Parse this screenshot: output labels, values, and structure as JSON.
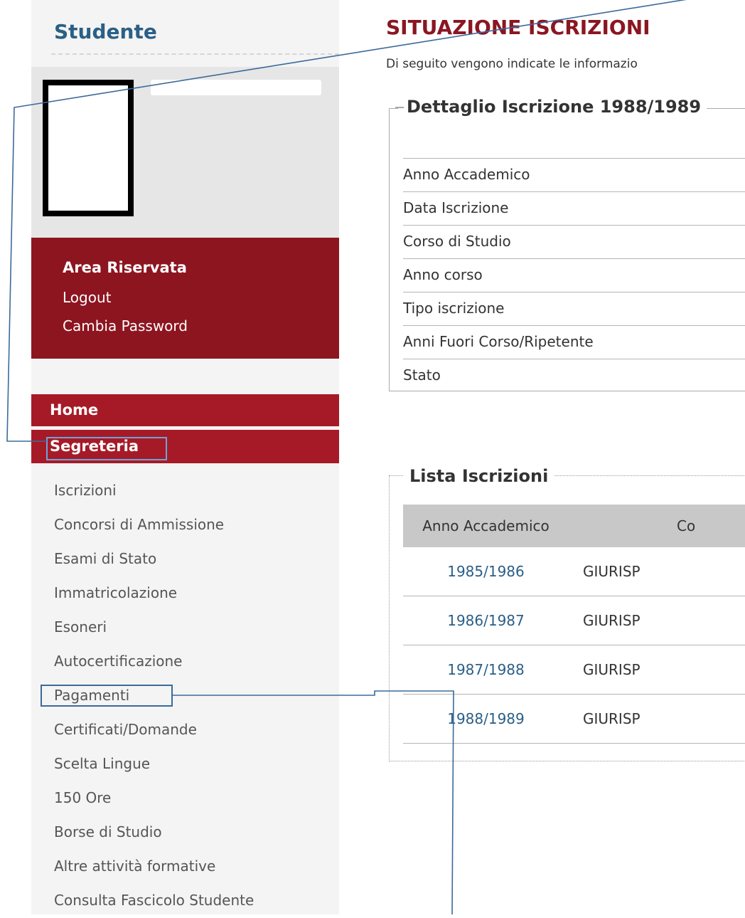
{
  "sidebar": {
    "title": "Studente",
    "reserved": {
      "title": "Area Riservata",
      "logout": "Logout",
      "change_password": "Cambia Password"
    },
    "nav": {
      "home": "Home",
      "segreteria": "Segreteria"
    },
    "submenu": [
      "Iscrizioni",
      "Concorsi di Ammissione",
      "Esami di Stato",
      "Immatricolazione",
      "Esoneri",
      "Autocertificazione",
      "Pagamenti",
      "Certificati/Domande",
      "Scelta Lingue",
      "150 Ore",
      "Borse di Studio",
      "Altre attività formative",
      "Consulta Fascicolo Studente"
    ]
  },
  "main": {
    "title": "SITUAZIONE ISCRIZIONI",
    "intro": "Di seguito vengono indicate le informazio",
    "detail": {
      "legend": "Dettaglio Iscrizione 1988/1989",
      "rows": [
        "Anno Accademico",
        "Data Iscrizione",
        "Corso di Studio",
        "Anno corso",
        "Tipo iscrizione",
        "Anni Fuori Corso/Ripetente",
        "Stato"
      ]
    },
    "list": {
      "legend": "Lista Iscrizioni",
      "headers": {
        "year": "Anno Accademico",
        "course": "Co"
      },
      "rows": [
        {
          "year": "1985/1986",
          "course": "GIURISP"
        },
        {
          "year": "1986/1987",
          "course": "GIURISP"
        },
        {
          "year": "1987/1988",
          "course": "GIURISP"
        },
        {
          "year": "1988/1989",
          "course": "GIURISP"
        }
      ]
    }
  },
  "colors": {
    "title_blue": "#2b5f86",
    "dark_red": "#8d1520",
    "nav_red": "#a61a27",
    "annotation_blue": "#3b6a9a"
  }
}
